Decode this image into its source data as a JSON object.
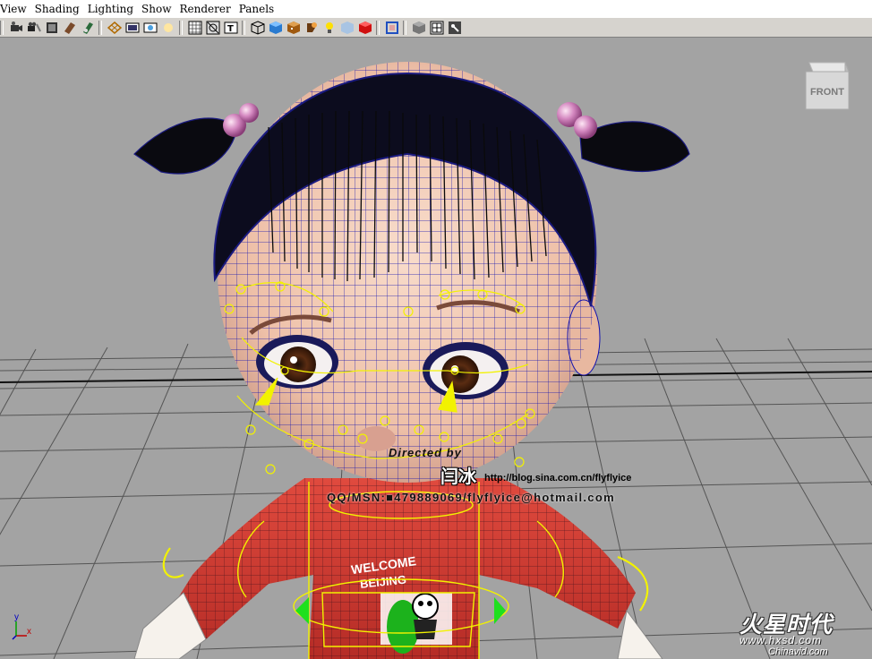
{
  "menu": {
    "items": [
      "View",
      "Shading",
      "Lighting",
      "Show",
      "Renderer",
      "Panels"
    ]
  },
  "toolbar": {
    "buttons": [
      {
        "name": "select-camera",
        "icon": "camera-icon"
      },
      {
        "name": "camera-attributes",
        "icon": "camera-attr-icon"
      },
      {
        "name": "bookmarks",
        "icon": "bookmark-icon"
      },
      {
        "name": "image-plane",
        "icon": "image-plane-icon"
      },
      {
        "name": "two-d-pan-zoom",
        "icon": "pan-zoom-icon"
      },
      {
        "name": "grease-pencil",
        "icon": "grease-pencil-icon"
      },
      {
        "name": "grid",
        "icon": "grid-icon"
      },
      {
        "name": "film-gate",
        "icon": "film-gate-icon"
      },
      {
        "name": "resolution-gate",
        "icon": "resolution-gate-icon"
      },
      {
        "name": "gate-mask",
        "icon": "gate-mask-icon"
      },
      {
        "name": "field-chart",
        "icon": "field-chart-icon"
      },
      {
        "name": "safe-action",
        "icon": "safe-action-icon"
      },
      {
        "name": "safe-title",
        "icon": "safe-title-icon"
      },
      {
        "name": "wireframe",
        "icon": "wireframe-icon"
      },
      {
        "name": "smooth-shade",
        "icon": "smooth-shade-icon"
      },
      {
        "name": "textured",
        "icon": "textured-icon"
      },
      {
        "name": "use-all-lights",
        "icon": "lightbulb-icon"
      },
      {
        "name": "shadows",
        "icon": "shadow-icon"
      },
      {
        "name": "xray",
        "icon": "xray-icon"
      },
      {
        "name": "isolate-select",
        "icon": "isolate-icon"
      },
      {
        "name": "wireframe-on-shaded",
        "icon": "wire-on-shaded-icon"
      },
      {
        "name": "backface-culling",
        "icon": "backface-icon"
      },
      {
        "name": "xray-joints",
        "icon": "xray-joints-icon"
      }
    ]
  },
  "viewport": {
    "viewcube_label": "FRONT",
    "axis_x": "x",
    "axis_y": "y",
    "credit": {
      "directed": "Directed by",
      "author": "闫冰",
      "blog": "http://blog.sina.com.cn/flyflyice",
      "qq": "QQ/MSN:■479889069/flyflyice@hotmail.com"
    },
    "watermark": {
      "brand": "火星时代",
      "site1": "www.hxsd.com",
      "site2": "Chinavid.com"
    }
  },
  "colors": {
    "viewport_bg": "#a3a3a3",
    "toolbar_bg": "#d6d3ce",
    "wire_blue": "#1010b0",
    "controller_yellow": "#f2f200",
    "shirt_red": "#d23a32",
    "skin": "#f0c8b2"
  }
}
